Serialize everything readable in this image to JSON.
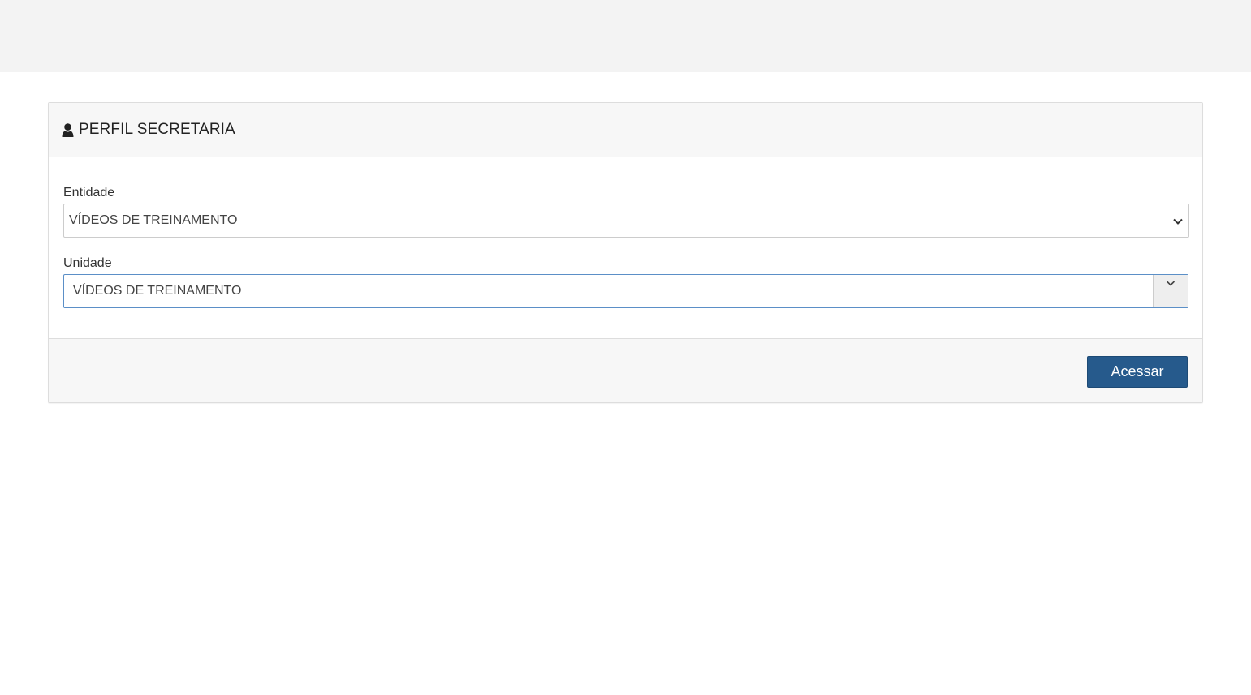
{
  "panel": {
    "title": "PERFIL SECRETARIA",
    "icon": "user-icon"
  },
  "form": {
    "entidade": {
      "label": "Entidade",
      "value": "VÍDEOS DE TREINAMENTO"
    },
    "unidade": {
      "label": "Unidade",
      "value": "VÍDEOS DE TREINAMENTO"
    }
  },
  "footer": {
    "submit_label": "Acessar"
  },
  "colors": {
    "topbar": "#f3f3f3",
    "primary": "#265a8c",
    "focus_border": "#5b8fc7"
  }
}
